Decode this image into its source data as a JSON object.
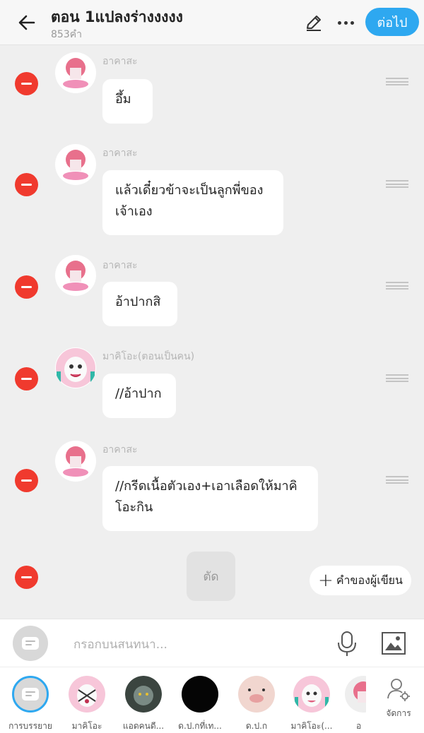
{
  "header": {
    "title": "ตอน 1แปลงร่างงงงง",
    "word_count": "853คำ",
    "next_label": "ต่อไป",
    "accent_color": "#2ea8f0"
  },
  "messages": [
    {
      "speaker": "อาคาสะ",
      "text": "อึ้ม",
      "avatar": "akaza-avatar"
    },
    {
      "speaker": "อาคาสะ",
      "text": "แล้วเดี๋ยวข้าจะเป็นลูกพี่ของเจ้าเอง",
      "avatar": "akaza-avatar"
    },
    {
      "speaker": "อาคาสะ",
      "text": "อ้าปากสิ",
      "avatar": "akaza-avatar"
    },
    {
      "speaker": "มาคิโอะ(ตอนเป็นคน)",
      "text": "//อ้าปาก",
      "avatar": "makio-avatar"
    },
    {
      "speaker": "อาคาสะ",
      "text": "//กรีดเนื้อตัวเอง+เอาเลือดให้มาคิโอะกิน",
      "avatar": "akaza-avatar"
    }
  ],
  "actions": {
    "cut_label": "ตัด",
    "author_note_label": "คำของผู้เขียน",
    "remove_color": "#f03a2e"
  },
  "input": {
    "placeholder": "กรอกบนสนทนา..."
  },
  "characters": [
    {
      "label": "การบรรยาย",
      "selected": true,
      "icon": "narration-icon"
    },
    {
      "label": "มาคิโอะ",
      "icon": "character-avatar"
    },
    {
      "label": "แอดคนดี...",
      "icon": "character-avatar"
    },
    {
      "label": "ด.ป.กที่เท...",
      "icon": "character-avatar"
    },
    {
      "label": "ด.ป.ก",
      "icon": "character-avatar"
    },
    {
      "label": "มาคิโอะ(...",
      "icon": "character-avatar"
    },
    {
      "label": "อ",
      "icon": "character-avatar"
    }
  ],
  "manage_label": "จัดการ"
}
